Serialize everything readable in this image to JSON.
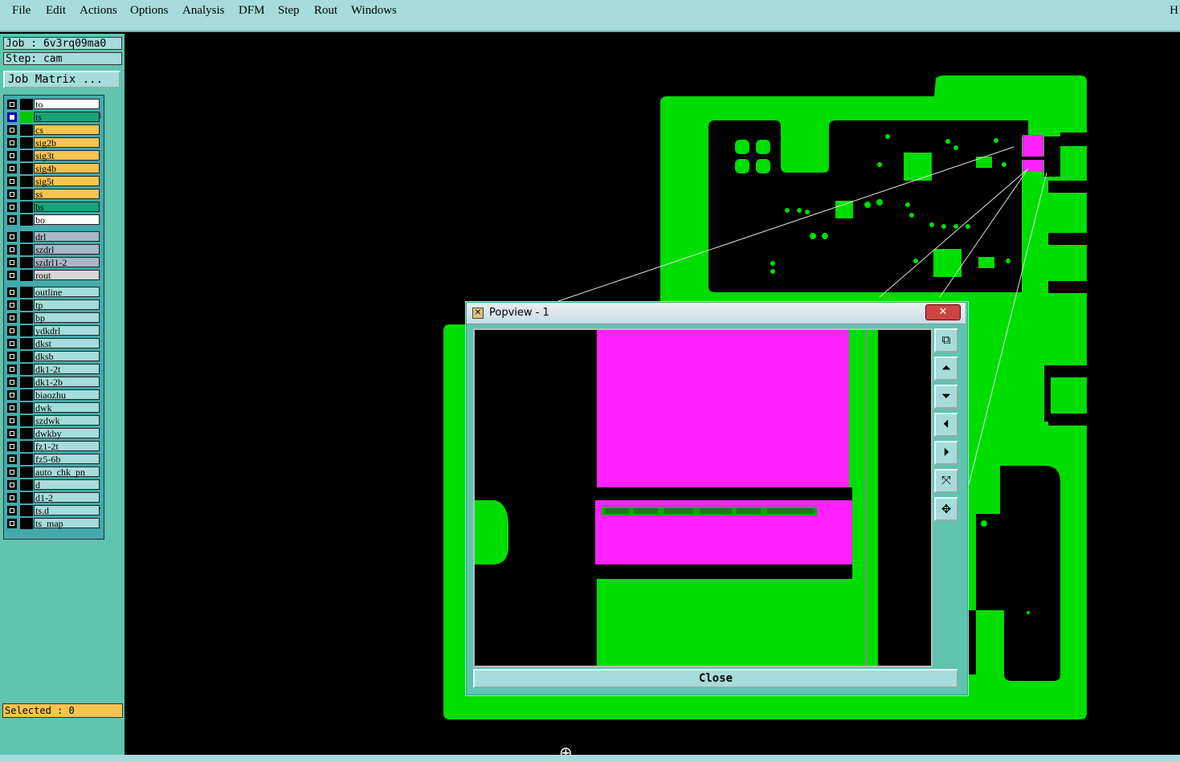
{
  "menubar": {
    "items": [
      "File",
      "Edit",
      "Actions",
      "Options",
      "Analysis",
      "DFM",
      "Step",
      "Rout",
      "Windows"
    ],
    "right_label": "H"
  },
  "job": {
    "label": "Job : 6v3rq09ma0",
    "step": "Step: cam",
    "matrix_button": "Job Matrix ..."
  },
  "layers": {
    "board": [
      {
        "name": "to",
        "color": "#ffffff"
      },
      {
        "name": "ts",
        "color": "#1aa37a",
        "selected": true,
        "mark": "⊞"
      },
      {
        "name": "cs",
        "color": "#f5c451"
      },
      {
        "name": "sig2b",
        "color": "#f5c451"
      },
      {
        "name": "sig3t",
        "color": "#f5c451"
      },
      {
        "name": "sig4b",
        "color": "#f5c451"
      },
      {
        "name": "sig5t",
        "color": "#f5c451"
      },
      {
        "name": "ss",
        "color": "#f5c451"
      },
      {
        "name": "bs",
        "color": "#1aa37a"
      },
      {
        "name": "bo",
        "color": "#ffffff"
      }
    ],
    "drill": [
      {
        "name": "drl",
        "color": "#a8b8c8"
      },
      {
        "name": "szdrl",
        "color": "#a8b8c8"
      },
      {
        "name": "szdrl1-2",
        "color": "#a8b8c8"
      },
      {
        "name": "rout",
        "color": "#d8d8d8"
      }
    ],
    "misc": [
      {
        "name": "outline"
      },
      {
        "name": "tp"
      },
      {
        "name": "bp"
      },
      {
        "name": "ydkdrl"
      },
      {
        "name": "dkst"
      },
      {
        "name": "dksb"
      },
      {
        "name": "dk1-2t"
      },
      {
        "name": "dk1-2b"
      },
      {
        "name": "biaozhu"
      },
      {
        "name": "dwk"
      },
      {
        "name": "szdwk"
      },
      {
        "name": "dwkby"
      },
      {
        "name": "fz1-2t"
      },
      {
        "name": "fz5-6b"
      },
      {
        "name": "auto_chk_pn"
      },
      {
        "name": "d"
      },
      {
        "name": "d1-2"
      },
      {
        "name": "ts.d",
        "mark": "⬋"
      },
      {
        "name": "ts_map"
      }
    ],
    "misc_color": "#a6dcdc"
  },
  "status": {
    "selected": "Selected : 0"
  },
  "popview": {
    "title": "Popview - 1",
    "close_x": "✕",
    "close_button": "Close",
    "tools": [
      {
        "name": "zoom-fit-icon",
        "glyph": "⧉"
      },
      {
        "name": "pan-up-icon",
        "glyph": "⏶"
      },
      {
        "name": "pan-down-icon",
        "glyph": "⏷"
      },
      {
        "name": "pan-left-icon",
        "glyph": "⏴"
      },
      {
        "name": "pan-right-icon",
        "glyph": "⏵"
      },
      {
        "name": "zoom-in-icon",
        "glyph": "⤧"
      },
      {
        "name": "zoom-out-icon",
        "glyph": "✥"
      }
    ]
  },
  "colors": {
    "copper": "#00dd00",
    "highlight": "#ff22ff",
    "panel": "#5fc4b0",
    "menu": "#a6dcdc"
  }
}
